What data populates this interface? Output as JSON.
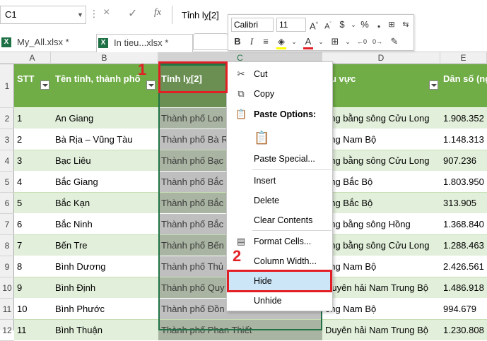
{
  "formula_bar": {
    "name_box": "C1",
    "cancel_icon": "×",
    "enter_icon": "✓",
    "fx_label": "fx",
    "content": "Tỉnh lỵ[2]"
  },
  "tabs": [
    {
      "label": "My_All.xlsx *"
    },
    {
      "label": "In tieu...xlsx *"
    }
  ],
  "column_headers": [
    "A",
    "B",
    "C",
    "D",
    "E"
  ],
  "row_numbers": [
    "1",
    "2",
    "3",
    "4",
    "5",
    "6",
    "7",
    "8",
    "9",
    "10",
    "11",
    "12"
  ],
  "header_row": {
    "a": "STT",
    "b": "Tên tỉnh, thành phố",
    "c": "Tỉnh lỵ[2]",
    "d": "hu vực",
    "e": "Dân số (ng"
  },
  "rows": [
    {
      "a": "1",
      "b": "An Giang",
      "c": "Thành phố Lon",
      "d": "òng bằng sông Cửu Long",
      "e": "1.908.352"
    },
    {
      "a": "2",
      "b": "Bà Rịa – Vũng Tàu",
      "c": "Thành phố Bà R",
      "d": "ông Nam Bộ",
      "e": "1.148.313"
    },
    {
      "a": "3",
      "b": "Bạc Liêu",
      "c": "Thành phố Bạc",
      "d": "òng bằng sông Cửu Long",
      "e": "907.236"
    },
    {
      "a": "4",
      "b": "Bắc Giang",
      "c": "Thành phố Bắc",
      "d": "òng Bắc Bộ",
      "e": "1.803.950"
    },
    {
      "a": "5",
      "b": "Bắc Kạn",
      "c": "Thành phố Bắc",
      "d": "òng Bắc Bộ",
      "e": "313.905"
    },
    {
      "a": "6",
      "b": "Bắc Ninh",
      "c": "Thành phố Bắc",
      "d": "òng bằng sông Hồng",
      "e": "1.368.840"
    },
    {
      "a": "7",
      "b": "Bến Tre",
      "c": "Thành phố Bến",
      "d": "òng bằng sông Cửu Long",
      "e": "1.288.463"
    },
    {
      "a": "8",
      "b": "Bình Dương",
      "c": "Thành phố Thủ",
      "d": "ông Nam Bộ",
      "e": "2.426.561"
    },
    {
      "a": "9",
      "b": "Bình Định",
      "c": "Thành phố Quy",
      "d": "Duyên hải Nam Trung Bộ",
      "e": "1.486.918"
    },
    {
      "a": "10",
      "b": "Bình Phước",
      "c": "Thành phố Đồn",
      "d": "ông Nam Bộ",
      "e": "994.679"
    },
    {
      "a": "11",
      "b": "Bình Thuận",
      "c": "Thành phố Phan Thiết",
      "d": "Duyên hải Nam Trung Bộ",
      "e": "1.230.808"
    }
  ],
  "mini_toolbar": {
    "font_name": "Calibri",
    "font_size": "11"
  },
  "context_menu": {
    "cut": "Cut",
    "copy": "Copy",
    "paste_options": "Paste Options:",
    "paste_special": "Paste Special...",
    "insert": "Insert",
    "delete": "Delete",
    "clear_contents": "Clear Contents",
    "format_cells": "Format Cells...",
    "column_width": "Column Width...",
    "hide": "Hide",
    "unhide": "Unhide"
  },
  "annotations": {
    "step1": "1",
    "step2": "2"
  },
  "colors": {
    "header_green": "#70ad47",
    "band_green": "#e2efda",
    "annotation_red": "#e31f26",
    "excel_green": "#217346"
  }
}
